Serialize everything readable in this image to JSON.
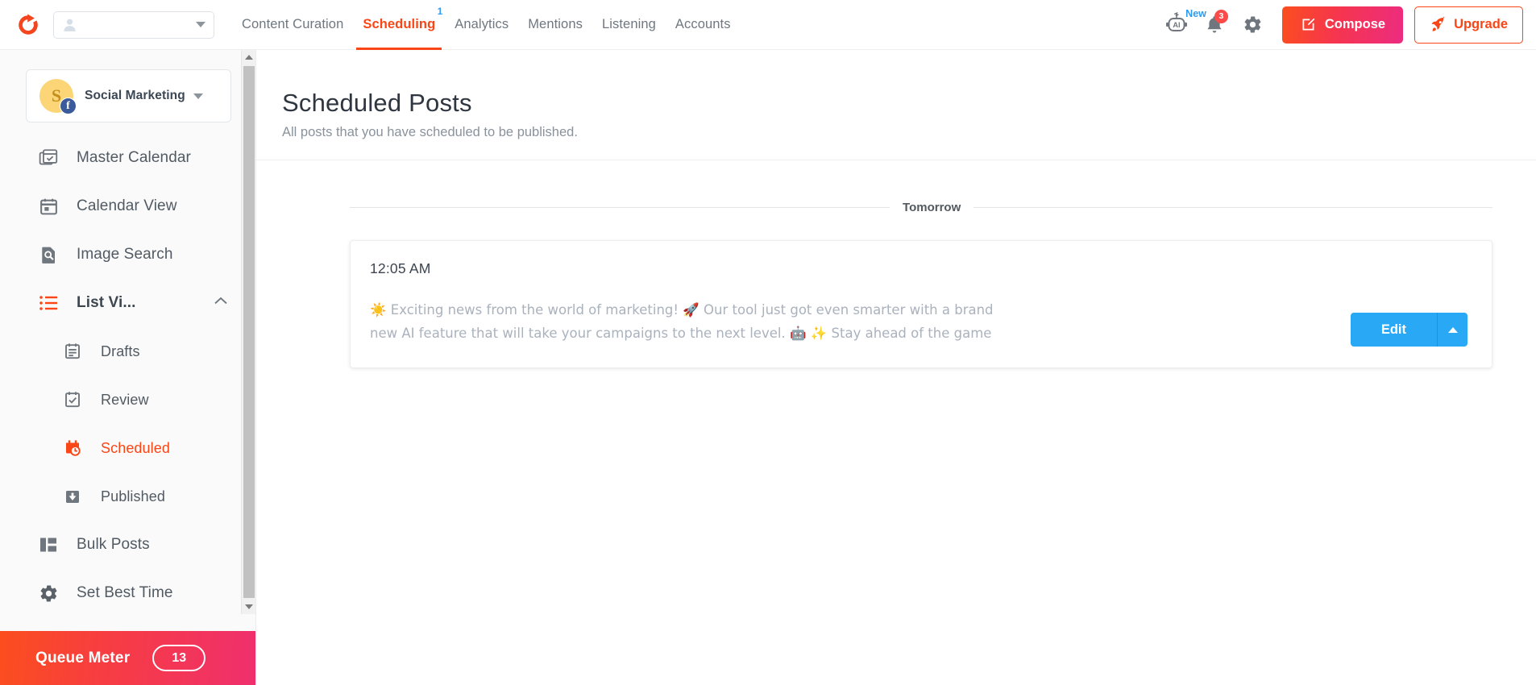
{
  "topnav": {
    "logo_icon": "social-pilot-logo-icon",
    "profile_selector": {
      "avatar_icon": "user-avatar-icon",
      "caret_icon": "chevron-down-icon",
      "value": ""
    },
    "items": [
      {
        "label": "Content Curation",
        "active": false,
        "badge": ""
      },
      {
        "label": "Scheduling",
        "active": true,
        "badge": "1"
      },
      {
        "label": "Analytics",
        "active": false,
        "badge": ""
      },
      {
        "label": "Mentions",
        "active": false,
        "badge": ""
      },
      {
        "label": "Listening",
        "active": false,
        "badge": ""
      },
      {
        "label": "Accounts",
        "active": false,
        "badge": ""
      }
    ],
    "ai_assistant": {
      "icon": "ai-robot-icon",
      "badge": "New"
    },
    "notifications": {
      "icon": "bell-icon",
      "count": "3"
    },
    "settings": {
      "icon": "gear-icon"
    },
    "compose_button": {
      "label": "Compose",
      "icon": "compose-pencil-icon"
    },
    "upgrade_button": {
      "label": "Upgrade",
      "icon": "rocket-icon"
    }
  },
  "sidebar": {
    "profile": {
      "initial": "S",
      "name": "Social Marketing",
      "network_icon": "facebook-icon",
      "caret_icon": "chevron-down-icon"
    },
    "items": [
      {
        "label": "Master Calendar",
        "icon": "master-calendar-icon",
        "active": false,
        "sub": false
      },
      {
        "label": "Calendar View",
        "icon": "calendar-icon",
        "active": false,
        "sub": false
      },
      {
        "label": "Image Search",
        "icon": "image-search-icon",
        "active": false,
        "sub": false
      },
      {
        "label": "List Vi...",
        "icon": "list-view-icon",
        "active": false,
        "sub": false,
        "group": true,
        "collapse_icon": "chevron-up-icon"
      },
      {
        "label": "Drafts",
        "icon": "drafts-icon",
        "active": false,
        "sub": true
      },
      {
        "label": "Review",
        "icon": "review-icon",
        "active": false,
        "sub": true
      },
      {
        "label": "Scheduled",
        "icon": "scheduled-clock-icon",
        "active": true,
        "sub": true
      },
      {
        "label": "Published",
        "icon": "published-icon",
        "active": false,
        "sub": true
      },
      {
        "label": "Bulk Posts",
        "icon": "bulk-posts-icon",
        "active": false,
        "sub": false
      },
      {
        "label": "Set Best Time",
        "icon": "gear-icon",
        "active": false,
        "sub": false
      }
    ],
    "queue_meter": {
      "label": "Queue Meter",
      "count": "13"
    },
    "scrollbar": {
      "up_icon": "scroll-up-arrow-icon",
      "down_icon": "scroll-down-arrow-icon"
    }
  },
  "main": {
    "title": "Scheduled Posts",
    "subtitle": "All posts that you have scheduled to be published.",
    "day_divider": "Tomorrow",
    "posts": [
      {
        "time": "12:05 AM",
        "text": "☀️ Exciting news from the world of marketing! 🚀 Our tool just got even smarter with a brand new AI feature that will take your campaigns to the next level. 🤖 ✨ Stay ahead of the game and try it out today! #Marketing…",
        "edit_label": "Edit",
        "dropdown_icon": "caret-up-icon"
      }
    ]
  }
}
